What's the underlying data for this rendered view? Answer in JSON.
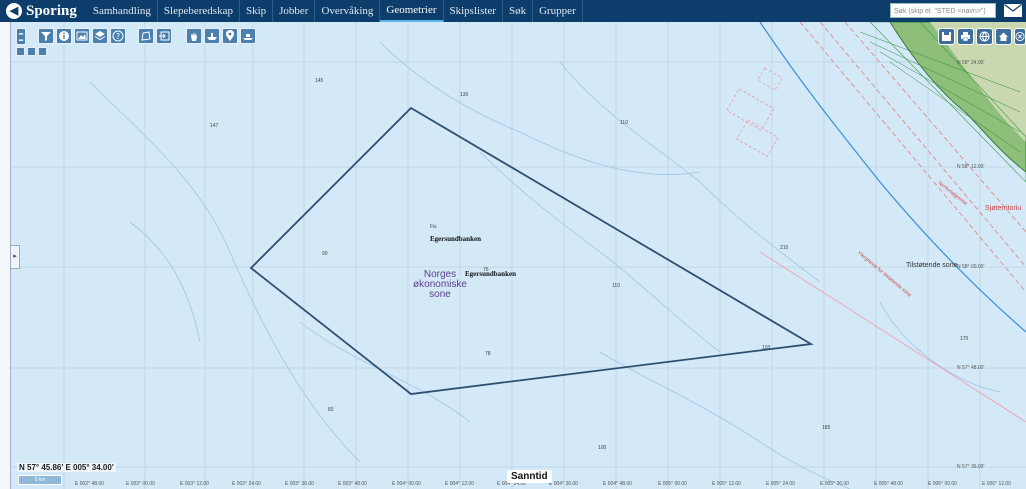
{
  "app": {
    "title": "Sporing",
    "logo_glyph": "◀"
  },
  "nav": {
    "items": [
      "Samhandling",
      "Slepeberedskap",
      "Skip",
      "Jobber",
      "Overvåking",
      "Geometrier",
      "Skipslister",
      "Søk",
      "Grupper"
    ],
    "active": "Geometrier"
  },
  "search": {
    "placeholder": "Søk (skip el. \"STED <navn>\")"
  },
  "map": {
    "labels": {
      "bank_small": "Egersundbanken",
      "bank_main": "Egersundbanken",
      "depth_code": "Fis",
      "eez_line1": "Norges",
      "eez_line2": "økonomiske",
      "eez_line3": "sone",
      "contiguous_zone": "Tilstøtende sone",
      "sea_label_1": "Sjøterritoriu",
      "sea_label_2": "Territorialgrense",
      "baseline_label": "Ytergrense for tilstøtende sone"
    },
    "latitudes": [
      "N 58° 24.00'",
      "N 58° 12.00'",
      "N 58° 00.00'",
      "N 57° 48.00'",
      "N 57° 36.00'"
    ],
    "longitudes": [
      "E 002° 36.00",
      "E 002° 48.00",
      "E 003° 00.00",
      "E 003° 12.00",
      "E 003° 24.00",
      "E 003° 36.00",
      "E 003° 48.00",
      "E 004° 00.00",
      "E 004° 12.00",
      "E 004° 24.00",
      "E 004° 36.00",
      "E 004° 48.00",
      "E 005° 00.00",
      "E 005° 12.00",
      "E 005° 24.00",
      "E 005° 36.00",
      "E 005° 48.00",
      "E 006° 00.00",
      "E 006° 12.00"
    ],
    "depths": [
      "145",
      "130",
      "110",
      "90",
      "76",
      "78",
      "80",
      "110",
      "103",
      "100",
      "210",
      "185",
      "147",
      "170"
    ]
  },
  "status": {
    "coordinate": "N 57° 45.86' E 005° 34.00'",
    "scale": "5 km",
    "mode": "Sanntid"
  },
  "colors": {
    "topbar": "#0d3d6b",
    "sea": "#d4e9f7",
    "polygon": "#2d4f70",
    "land": "#7ab86a"
  }
}
